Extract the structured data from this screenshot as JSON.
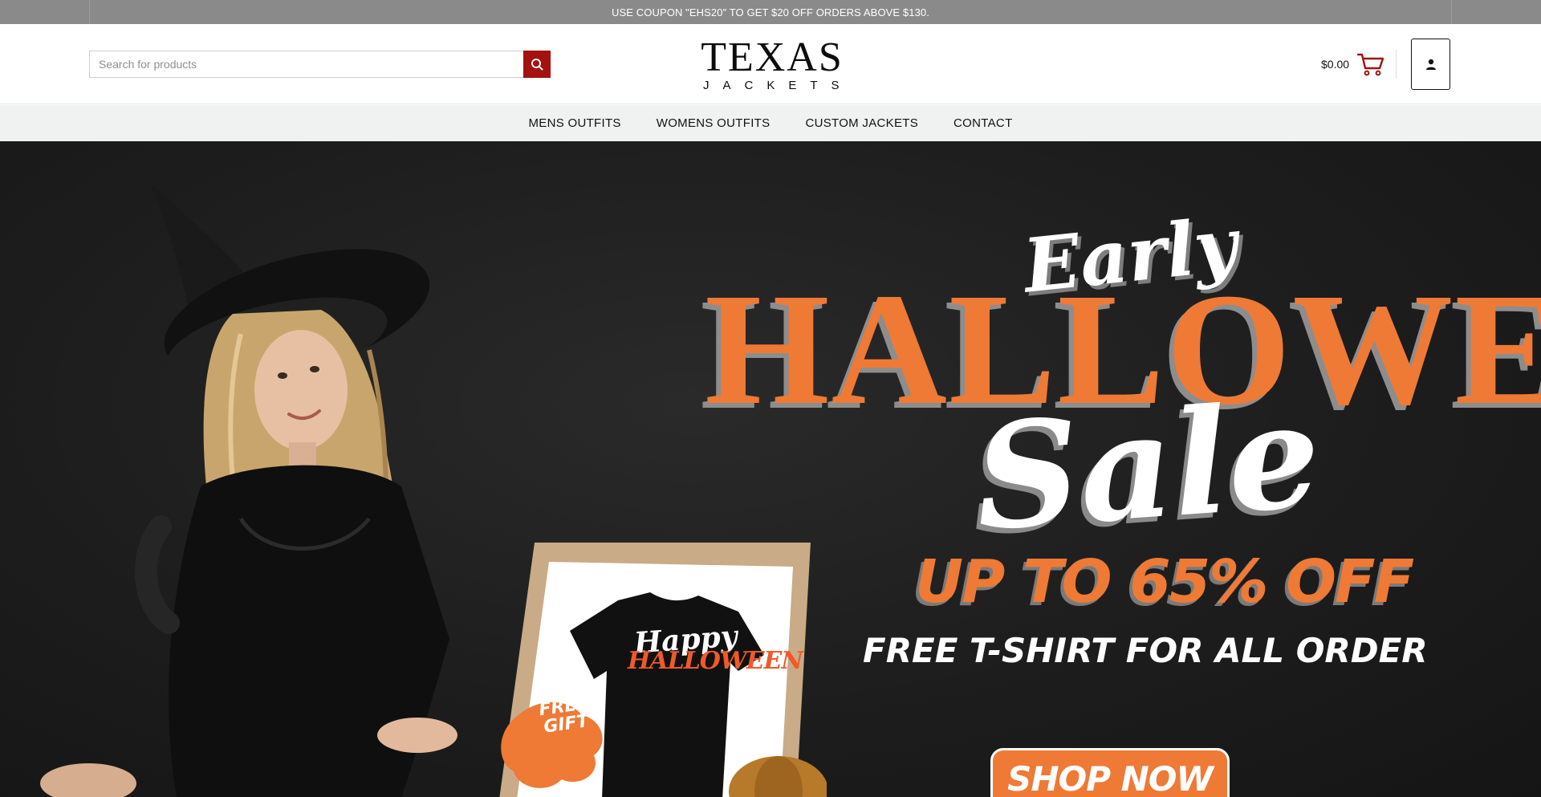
{
  "topbar": {
    "coupon_text": "USE COUPON \"EHS20\" TO GET $20 OFF ORDERS ABOVE $130."
  },
  "header": {
    "search": {
      "placeholder": "Search for products"
    },
    "logo": {
      "title": "TEXAS",
      "subtitle": "JACKETS"
    },
    "cart": {
      "total": "$0.00"
    }
  },
  "nav": {
    "items": [
      {
        "label": "MENS OUTFITS"
      },
      {
        "label": "WOMENS OUTFITS"
      },
      {
        "label": "CUSTOM JACKETS"
      },
      {
        "label": "CONTACT"
      }
    ]
  },
  "hero": {
    "early": "Early",
    "halloween": "HALLOWEEN",
    "sale": "Sale",
    "discount": "UP TO 65% OFF",
    "offer": "FREE T-SHIRT FOR ALL ORDER",
    "cta": "SHOP NOW",
    "tee_line1": "Happy",
    "tee_line2": "HALLOWEEN",
    "gift": "FREE GIFT"
  },
  "colors": {
    "brand_red": "#a3120f",
    "orange": "#ee7a36",
    "topbar": "#8a8a8a",
    "nav_bg": "#f0f1f1"
  },
  "icons": [
    "search-icon",
    "cart-icon",
    "user-icon"
  ]
}
